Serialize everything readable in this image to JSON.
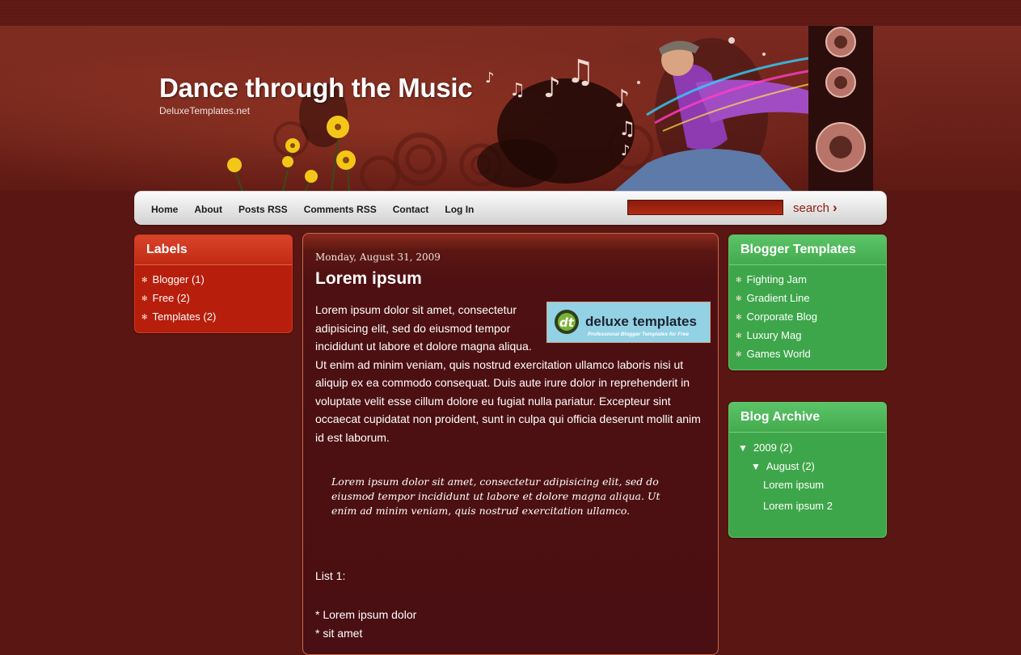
{
  "header": {
    "title": "Dance through the Music",
    "subtitle": "DeluxeTemplates.net"
  },
  "nav": {
    "items": [
      "Home",
      "About",
      "Posts RSS",
      "Comments RSS",
      "Contact",
      "Log In"
    ],
    "search_label": "search",
    "search_value": ""
  },
  "labels_widget": {
    "title": "Labels",
    "items": [
      "Blogger (1)",
      "Free (2)",
      "Templates (2)"
    ]
  },
  "post": {
    "date": "Monday, August 31, 2009",
    "title": "Lorem ipsum",
    "body": "Lorem ipsum dolor sit amet, consectetur adipisicing elit, sed do eiusmod tempor incididunt ut labore et dolore magna aliqua. Ut enim ad minim veniam, quis nostrud exercitation ullamco laboris nisi ut aliquip ex ea commodo consequat. Duis aute irure dolor in reprehenderit in voluptate velit esse cillum dolore eu fugiat nulla pariatur. Excepteur sint occaecat cupidatat non proident, sunt in culpa qui officia deserunt mollit anim id est laborum.",
    "quote": "Lorem ipsum dolor sit amet, consectetur adipisicing elit, sed do eiusmod tempor incididunt ut labore et dolore magna aliqua. Ut enim ad minim veniam, quis nostrud exercitation ullamco.",
    "list_title": "List 1:",
    "list_items": [
      "* Lorem ipsum dolor",
      "* sit amet"
    ],
    "image": {
      "brand": "deluxe templates",
      "tagline": "Professional Blogger Templates for Free",
      "logo_letters": "dt"
    }
  },
  "templates_widget": {
    "title": "Blogger Templates",
    "items": [
      "Fighting Jam",
      "Gradient Line",
      "Corporate Blog",
      "Luxury Mag",
      "Games World"
    ]
  },
  "archive_widget": {
    "title": "Blog Archive",
    "expand_glyph": "▼",
    "year": "2009",
    "year_count": "(2)",
    "month": "August",
    "month_count": "(2)",
    "posts": [
      "Lorem ipsum",
      "Lorem ipsum 2"
    ]
  },
  "colors": {
    "page_bg": "#5a1612",
    "labels_bg": "#b81e0c",
    "widget_green": "#3ea64a",
    "post_bg": "#4a0f12",
    "search_text": "#8f1d12"
  },
  "icons": {
    "list_bullet": "✻",
    "search_arrow": "›"
  }
}
